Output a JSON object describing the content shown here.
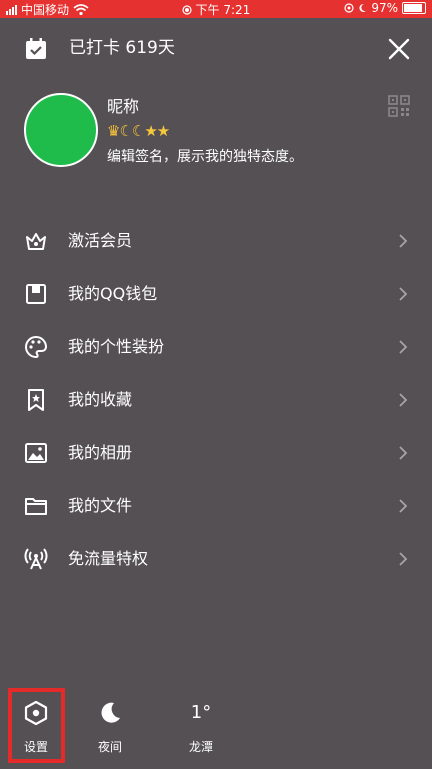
{
  "status_bar": {
    "carrier": "中国移动",
    "time": "下午 7:21",
    "battery": "97%"
  },
  "header": {
    "checkin_text": "已打卡 619天"
  },
  "profile": {
    "nickname": "昵称",
    "badges": "👑🌙🌙⭐⭐",
    "signature": "编辑签名，展示我的独特态度。",
    "avatar_color": "#1fbb4b"
  },
  "menu": [
    {
      "label": "激活会员",
      "icon": "crown-icon"
    },
    {
      "label": "我的QQ钱包",
      "icon": "wallet-icon"
    },
    {
      "label": "我的个性装扮",
      "icon": "palette-icon"
    },
    {
      "label": "我的收藏",
      "icon": "bookmark-star-icon"
    },
    {
      "label": "我的相册",
      "icon": "image-icon"
    },
    {
      "label": "我的文件",
      "icon": "folder-icon"
    },
    {
      "label": "免流量特权",
      "icon": "signal-tower-icon"
    }
  ],
  "bottom": {
    "settings_label": "设置",
    "night_label": "夜间",
    "weather_temp": "1°",
    "weather_city": "龙潭"
  },
  "colors": {
    "background": "#545054",
    "status_bar": "#e5312f",
    "highlight": "#e52a2a"
  }
}
